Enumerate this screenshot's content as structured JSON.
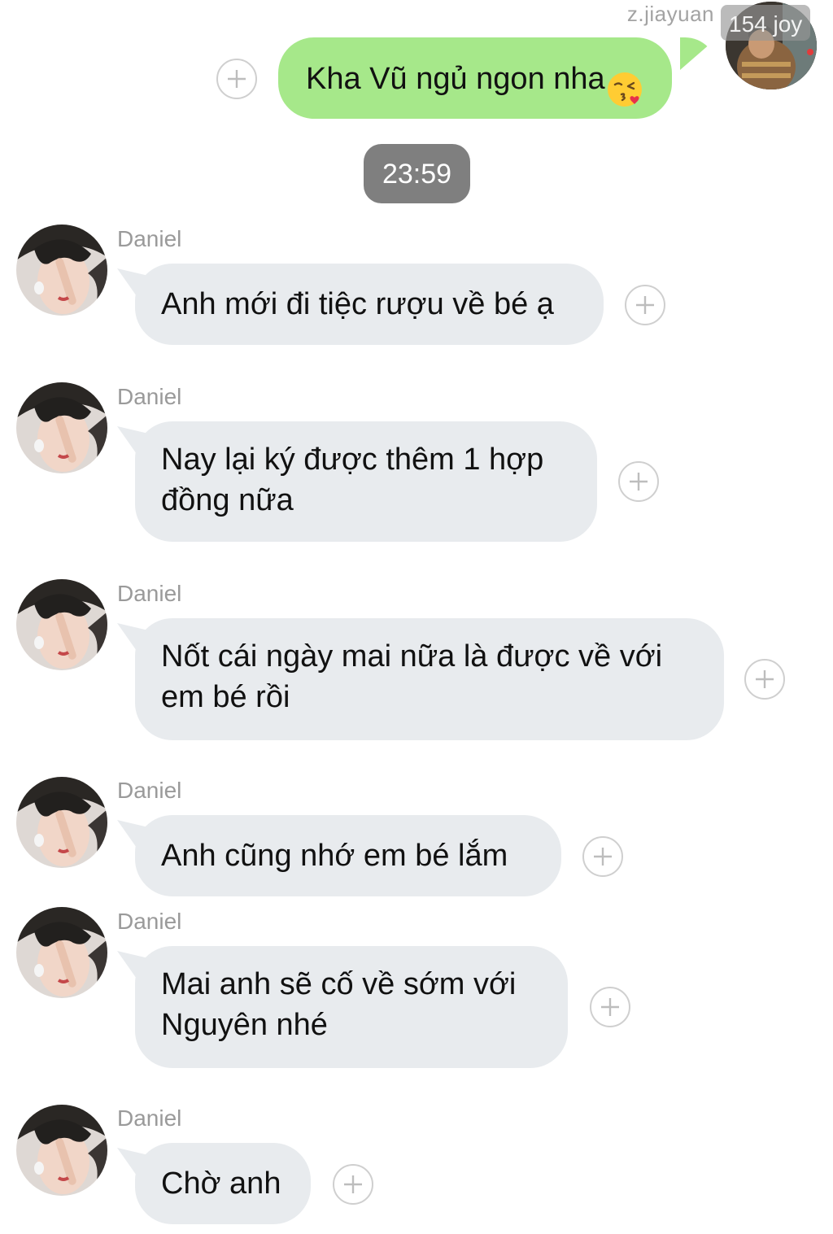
{
  "outgoing": {
    "sender_name": "z.jiayuan",
    "watermark": "154 joy",
    "text": "Kha Vũ ngủ ngon nha",
    "emoji_icon": "kissing-face-with-heart-icon",
    "bubble_color": "#a6e88a"
  },
  "timestamp": "23:59",
  "incoming": [
    {
      "sender": "Daniel",
      "text": "Anh mới đi tiệc rượu về bé ạ"
    },
    {
      "sender": "Daniel",
      "text": "Nay lại ký được thêm 1 hợp đồng nữa"
    },
    {
      "sender": "Daniel",
      "text": "Nốt cái ngày mai nữa là được về với em bé rồi"
    },
    {
      "sender": "Daniel",
      "text": "Anh cũng nhớ em bé lắm"
    },
    {
      "sender": "Daniel",
      "text": "Mai anh sẽ cố về sớm với Nguyên nhé"
    },
    {
      "sender": "Daniel",
      "text": "Chờ anh"
    }
  ],
  "colors": {
    "incoming_bubble": "#e8ebee",
    "timestamp_bg": "#7f7f7f"
  }
}
